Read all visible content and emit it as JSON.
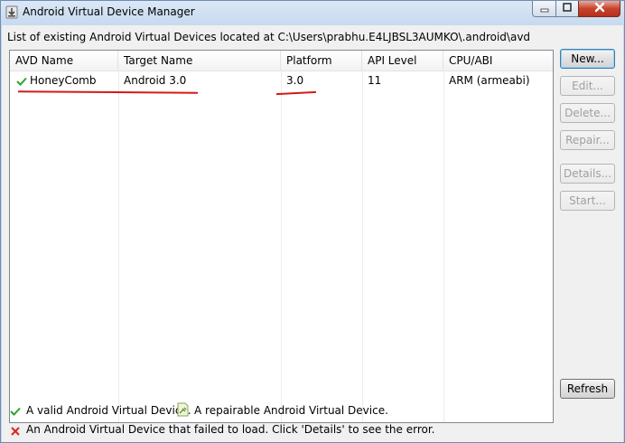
{
  "window": {
    "title": "Android Virtual Device Manager"
  },
  "location_label": "List of existing Android Virtual Devices located at C:\\Users\\prabhu.E4LJBSL3AUMKO\\.android\\avd",
  "table": {
    "columns": [
      "AVD Name",
      "Target Name",
      "Platform",
      "API Level",
      "CPU/ABI"
    ],
    "rows": [
      {
        "status_icon": "check-icon",
        "avd_name": "HoneyComb",
        "target_name": "Android 3.0",
        "platform": "3.0",
        "api_level": "11",
        "cpu_abi": "ARM (armeabi)"
      }
    ]
  },
  "buttons": {
    "new": "New...",
    "edit": "Edit...",
    "delete": "Delete...",
    "repair": "Repair...",
    "details": "Details...",
    "start": "Start...",
    "refresh": "Refresh"
  },
  "legend": {
    "valid": "A valid Android Virtual Device.",
    "repairable": "A repairable Android Virtual Device.",
    "failed": "An Android Virtual Device that failed to load. Click 'Details' to see the error."
  },
  "colors": {
    "valid_check": "#2aa52a",
    "failed_x": "#d9261c",
    "annotation": "#d21a1a"
  }
}
